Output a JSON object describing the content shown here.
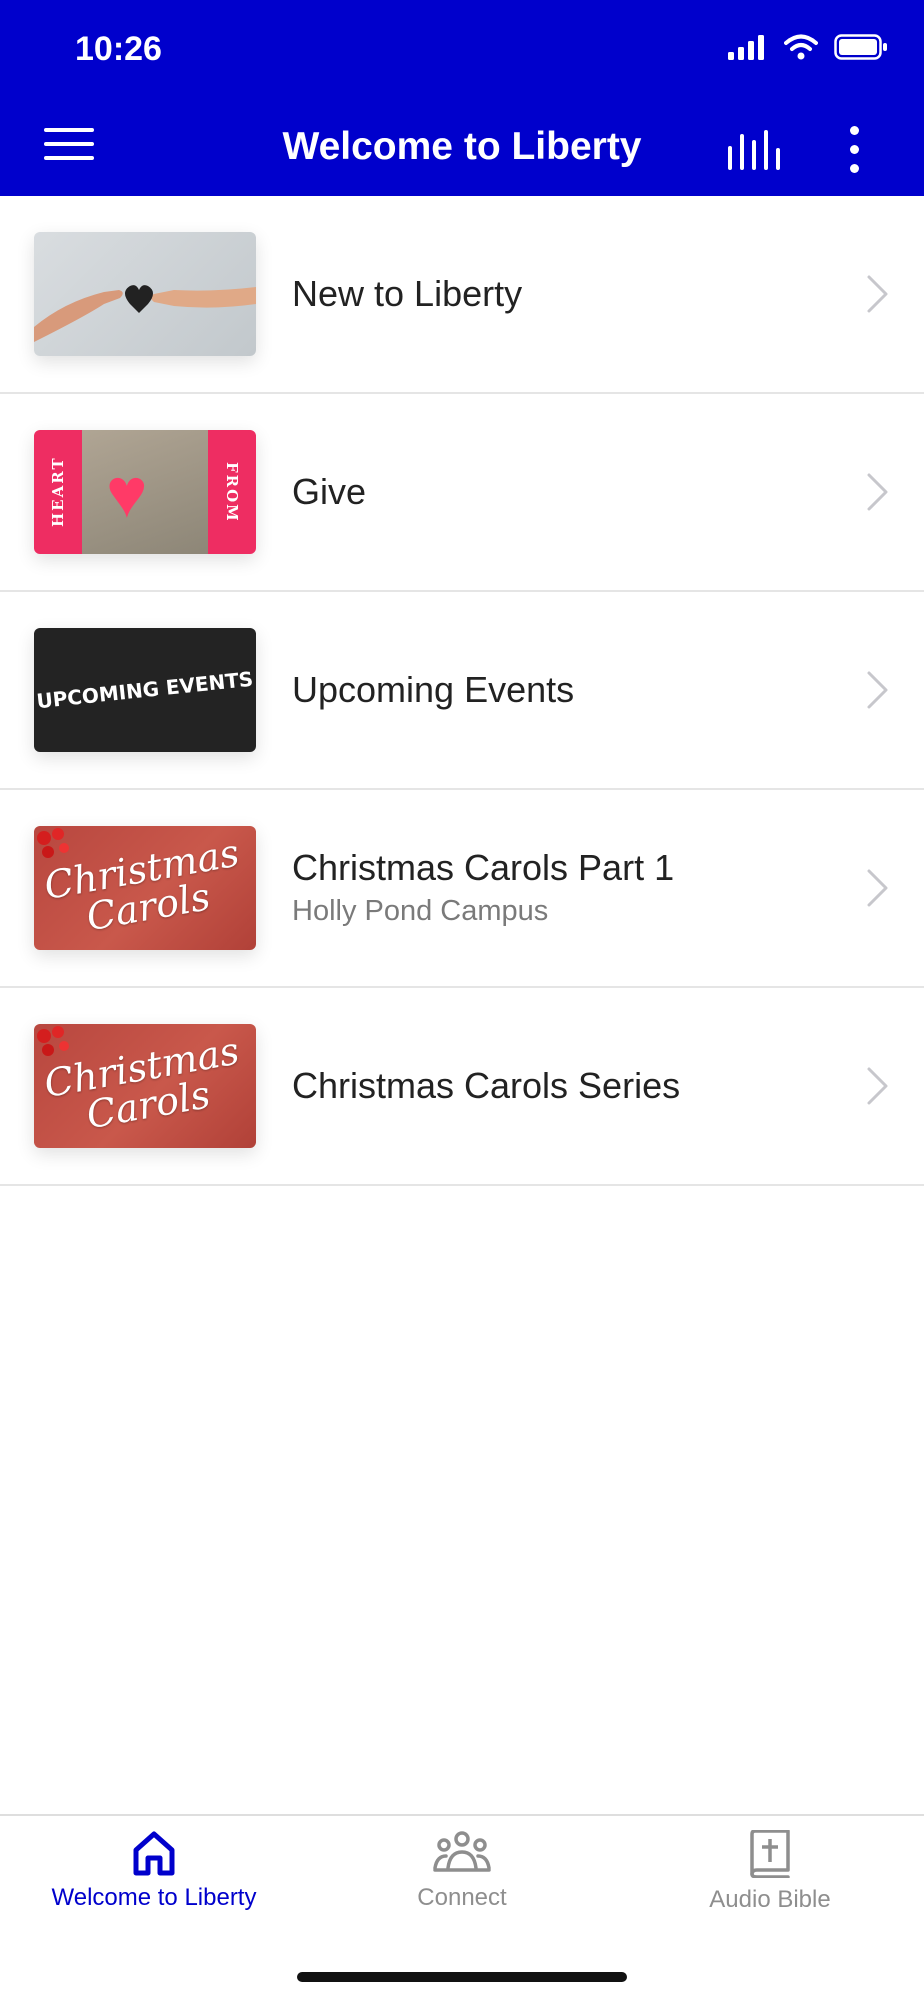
{
  "status": {
    "time": "10:26"
  },
  "header": {
    "title": "Welcome to Liberty"
  },
  "items": [
    {
      "title": "New to Liberty",
      "subtitle": "",
      "thumbnail": "hands-heart"
    },
    {
      "title": "Give",
      "subtitle": "",
      "thumbnail": "heart-from",
      "thumb_text_left": "HEART",
      "thumb_text_right": "FROM"
    },
    {
      "title": "Upcoming Events",
      "subtitle": "",
      "thumbnail": "upcoming-events",
      "thumb_text": "UPCOMING EVENTS"
    },
    {
      "title": "Christmas Carols Part 1",
      "subtitle": "Holly Pond Campus",
      "thumbnail": "christmas-carols",
      "thumb_text": "Christmas Carols"
    },
    {
      "title": "Christmas Carols Series",
      "subtitle": "",
      "thumbnail": "christmas-carols",
      "thumb_text": "Christmas Carols"
    }
  ],
  "tabs": [
    {
      "label": "Welcome to Liberty",
      "icon": "home-icon",
      "active": true
    },
    {
      "label": "Connect",
      "icon": "people-icon",
      "active": false
    },
    {
      "label": "Audio Bible",
      "icon": "bible-icon",
      "active": false
    }
  ],
  "colors": {
    "brand": "#0000cc",
    "inactive": "#8e8e8e"
  }
}
